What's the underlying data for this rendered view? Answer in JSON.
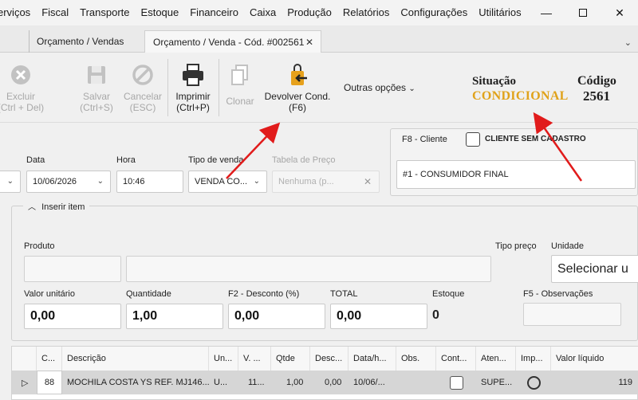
{
  "menu": [
    "erviços",
    "Fiscal",
    "Transporte",
    "Estoque",
    "Financeiro",
    "Caixa",
    "Produção",
    "Relatórios",
    "Configurações",
    "Utilitários"
  ],
  "tabs": {
    "inactive": "Orçamento / Vendas",
    "active": "Orçamento / Venda - Cód. #002561"
  },
  "toolbar": {
    "excluir": [
      "Excluir",
      "(Ctrl + Del)"
    ],
    "salvar": [
      "Salvar",
      "(Ctrl+S)"
    ],
    "cancelar": [
      "Cancelar",
      "(ESC)"
    ],
    "imprimir": [
      "Imprimir",
      "(Ctrl+P)"
    ],
    "clonar": "Clonar",
    "devolver": [
      "Devolver Cond.",
      "(F6)"
    ],
    "outras": "Outras opções"
  },
  "status": {
    "situacao_label": "Situação",
    "situacao_value": "CONDICIONAL",
    "codigo_label": "Código",
    "codigo_value": "2561",
    "accent": "#e0a21a"
  },
  "header": {
    "data_label": "Data",
    "data_value": "10/06/2026",
    "hora_label": "Hora",
    "hora_value": "10:46",
    "tipo_label": "Tipo de venda",
    "tipo_value": "VENDA CO...",
    "tabela_label": "Tabela de Preço",
    "tabela_value": "Nenhuma (p..."
  },
  "cliente": {
    "f8_label": "F8 - Cliente",
    "sem_cadastro": "CLIENTE SEM CADASTRO",
    "value": "#1 - CONSUMIDOR FINAL"
  },
  "item": {
    "title": "Inserir item",
    "produto": "Produto",
    "tipo_preco": "Tipo preço",
    "unidade": "Unidade",
    "unidade_value": "Selecionar u",
    "valor_unit_label": "Valor unitário",
    "valor_unit": "0,00",
    "qtd_label": "Quantidade",
    "qtd": "1,00",
    "desc_label": "F2 - Desconto (%)",
    "desc": "0,00",
    "total_label": "TOTAL",
    "total": "0,00",
    "estoque_label": "Estoque",
    "estoque": "0",
    "obs_label": "F5 - Observações"
  },
  "grid": {
    "headers": [
      "C...",
      "Descrição",
      "Un...",
      "V. ...",
      "Qtde",
      "Desc...",
      "Data/h...",
      "Obs.",
      "Cont...",
      "Aten...",
      "Imp...",
      "Valor líquido"
    ],
    "row": [
      "88",
      "MOCHILA COSTA YS REF. MJ146...",
      "U...",
      "11...",
      "1,00",
      "0,00",
      "10/06/...",
      "",
      "",
      "SUPE...",
      "",
      "119"
    ]
  }
}
